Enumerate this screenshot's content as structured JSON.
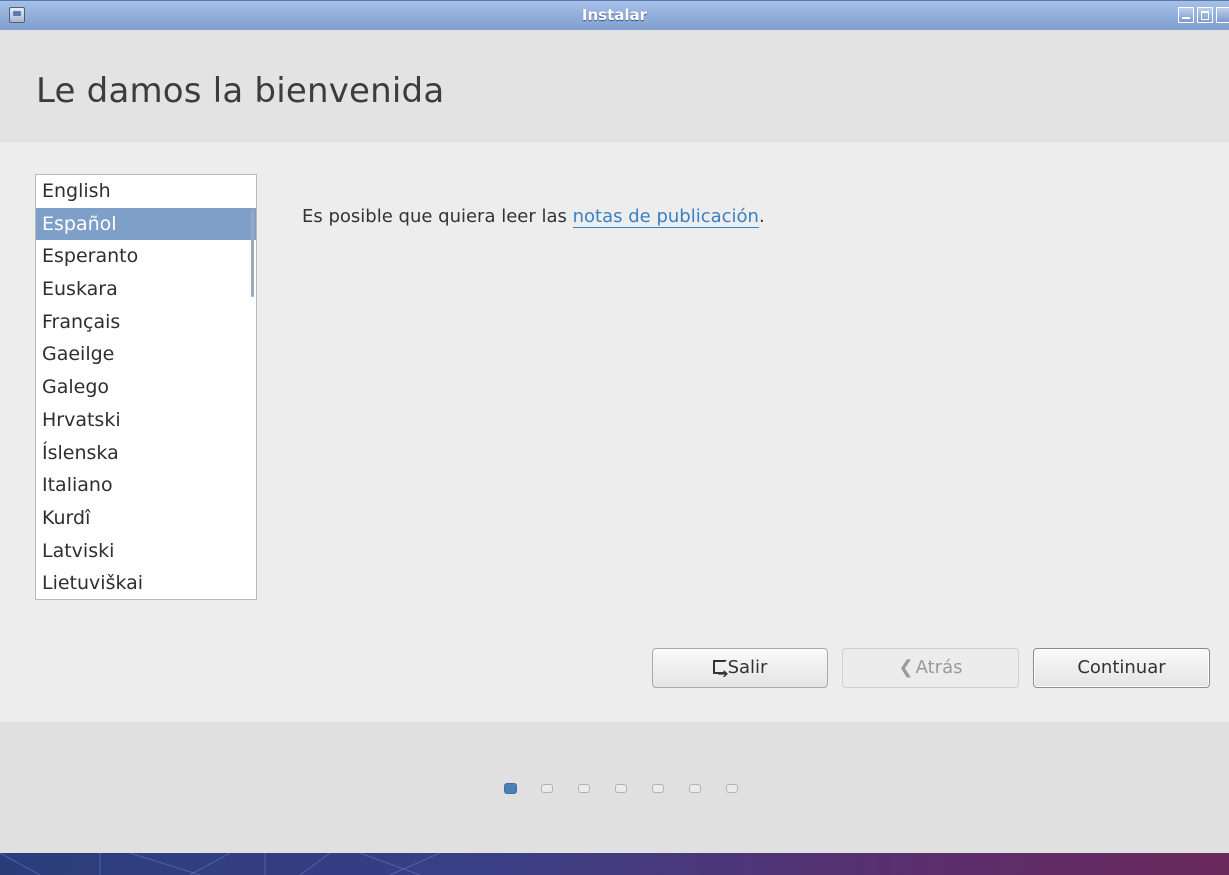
{
  "window": {
    "title": "Instalar"
  },
  "header": {
    "title": "Le damos la bienvenida"
  },
  "languages": {
    "items": [
      "English",
      "Español",
      "Esperanto",
      "Euskara",
      "Français",
      "Gaeilge",
      "Galego",
      "Hrvatski",
      "Íslenska",
      "Italiano",
      "Kurdî",
      "Latviski",
      "Lietuviškai"
    ],
    "selected": "Español"
  },
  "intro": {
    "text_before": "Es posible que quiera leer las ",
    "link_text": "notas de publicación",
    "text_after": "."
  },
  "buttons": {
    "quit": "Salir",
    "back": "Atrás",
    "continue": "Continuar"
  },
  "progress": {
    "total_steps": 7,
    "current_step": 1
  },
  "colors": {
    "selection": "#7e9fc7",
    "link": "#3b7fc4",
    "progress_active": "#4a7fb8",
    "titlebar": "#8fade0"
  }
}
